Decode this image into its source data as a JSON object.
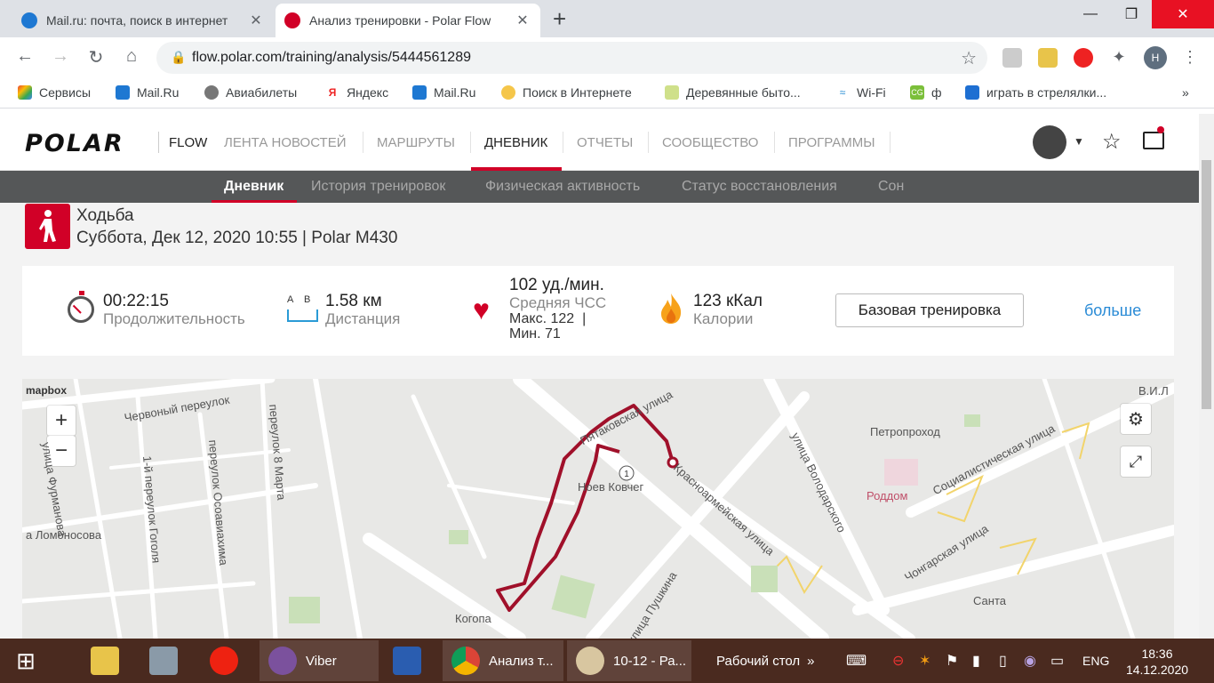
{
  "browser": {
    "tabs": [
      {
        "title": "Mail.ru: почта, поиск в интернет",
        "active": false
      },
      {
        "title": "Анализ тренировки - Polar Flow",
        "active": true
      }
    ],
    "url": "flow.polar.com/training/analysis/5444561289",
    "profile_initial": "H",
    "bookmarks": [
      "Сервисы",
      "Mail.Ru",
      "Авиабилеты",
      "Яндекс",
      "Mail.Ru",
      "Поиск в Интернете",
      "Деревянные быто...",
      "Wi-Fi",
      "ф",
      "играть в стрелялки..."
    ]
  },
  "polar": {
    "logo": "POLAR",
    "product": "FLOW",
    "nav": [
      "ЛЕНТА НОВОСТЕЙ",
      "МАРШРУТЫ",
      "ДНЕВНИК",
      "ОТЧЕТЫ",
      "СООБЩЕСТВО",
      "ПРОГРАММЫ"
    ],
    "active_nav": "ДНЕВНИК",
    "subnav": [
      "Дневник",
      "История тренировок",
      "Физическая активность",
      "Статус восстановления",
      "Сон"
    ],
    "active_subnav": "Дневник"
  },
  "activity": {
    "type": "Ходьба",
    "subtitle": "Суббота, Дек 12, 2020 10:55 | Polar M430",
    "duration_value": "00:22:15",
    "duration_label": "Продолжительность",
    "distance_ab": "A    B",
    "distance_value": "1.58 км",
    "distance_label": "Дистанция",
    "hr_value": "102 уд./мин.",
    "hr_label": "Средняя ЧСС",
    "hr_max": "Макс. 122  |",
    "hr_min": "Мин. 71",
    "calories_value": "123 кКал",
    "calories_label": "Калории",
    "training_type_button": "Базовая тренировка",
    "more_link": "больше"
  },
  "map": {
    "attribution": "mapbox",
    "zoom_in": "+",
    "zoom_out": "−",
    "route_color": "#a0102a",
    "labels": [
      "Червоный переулок",
      "улица Фурманова",
      "1-й переулок Гоголя",
      "переулок Осоавиахима",
      "переулок 8 Марта",
      "а Ломоносова",
      "Пятаковская улица",
      "Ноев Ковчег",
      "Красноармейская улица",
      "улица Пушкина",
      "Когопа",
      "улица Володарского",
      "Петропроход",
      "Роддом",
      "Социалистическая улица",
      "Чонгарская улица",
      "Санта",
      "В.И.Л"
    ]
  },
  "taskbar": {
    "items": [
      "Viber",
      "Анализ т...",
      "10-12 - Ра...",
      "Рабочий стол"
    ],
    "language": "ENG",
    "time": "18:36",
    "date": "14.12.2020"
  }
}
